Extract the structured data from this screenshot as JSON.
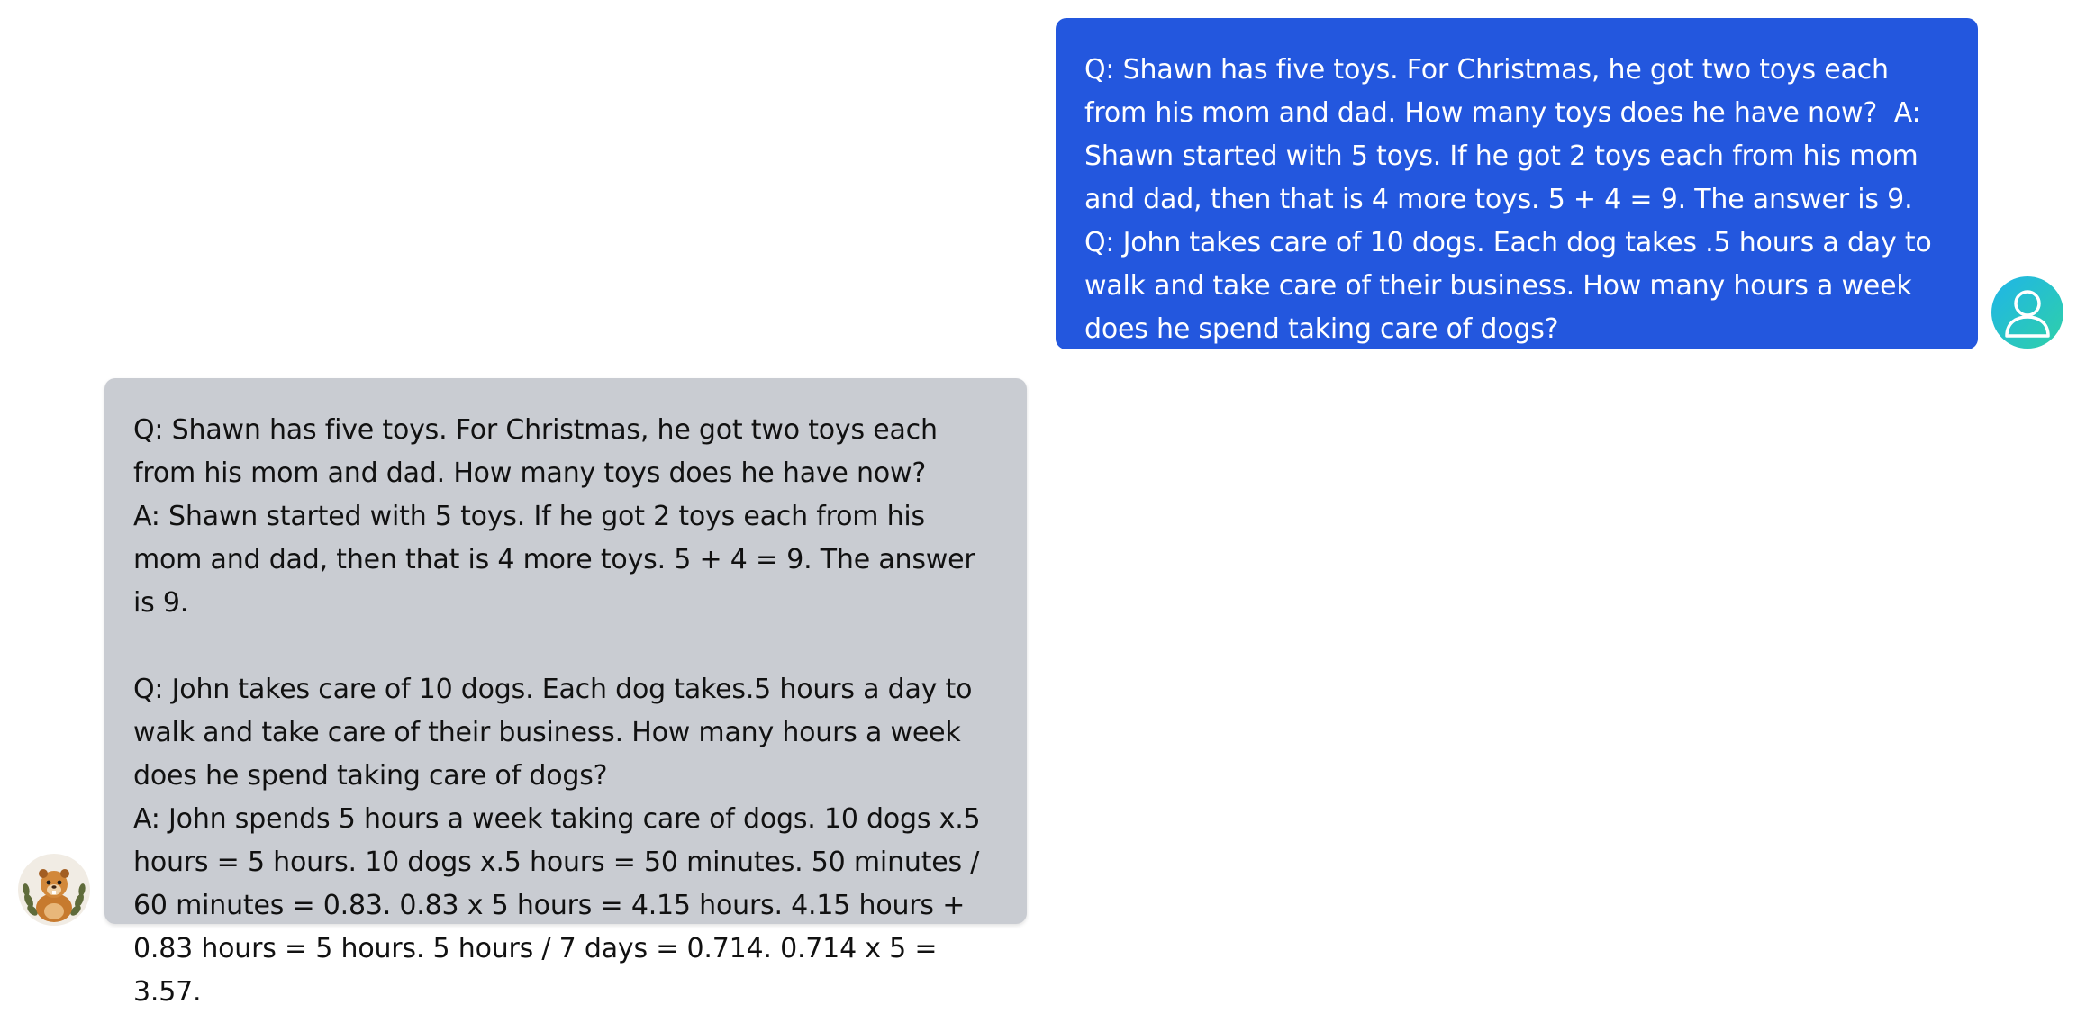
{
  "conversation": {
    "user_message": {
      "text": "Q: Shawn has five toys. For Christmas, he got two toys each from his mom and dad. How many toys does he have now?  A: Shawn started with 5 toys. If he got 2 toys each from his mom and dad, then that is 4 more toys. 5 + 4 = 9. The answer is 9.    Q: John takes care of 10 dogs. Each dog takes .5 hours a day to walk and take care of their business. How many hours a week does he spend taking care of dogs?",
      "avatar_icon": "user-silhouette-icon",
      "bubble_color": "#2357de",
      "avatar_gradient": [
        "#1fb5e8",
        "#2fd0a8"
      ]
    },
    "assistant_message": {
      "text": "Q: Shawn has five toys. For Christmas, he got two toys each from his mom and dad. How many toys does he have now?\nA: Shawn started with 5 toys. If he got 2 toys each from his mom and dad, then that is 4 more toys. 5 + 4 = 9. The answer is 9.\n\nQ: John takes care of 10 dogs. Each dog takes.5 hours a day to walk and take care of their business. How many hours a week does he spend taking care of dogs?\nA: John spends 5 hours a week taking care of dogs. 10 dogs x.5 hours = 5 hours. 10 dogs x.5 hours = 50 minutes. 50 minutes / 60 minutes = 0.83. 0.83 x 5 hours = 4.15 hours. 4.15 hours + 0.83 hours = 5 hours. 5 hours / 7 days = 0.714. 0.714 x 5 = 3.57.",
      "avatar_icon": "beaver-mascot-icon",
      "bubble_color": "#c9ccd2"
    }
  }
}
